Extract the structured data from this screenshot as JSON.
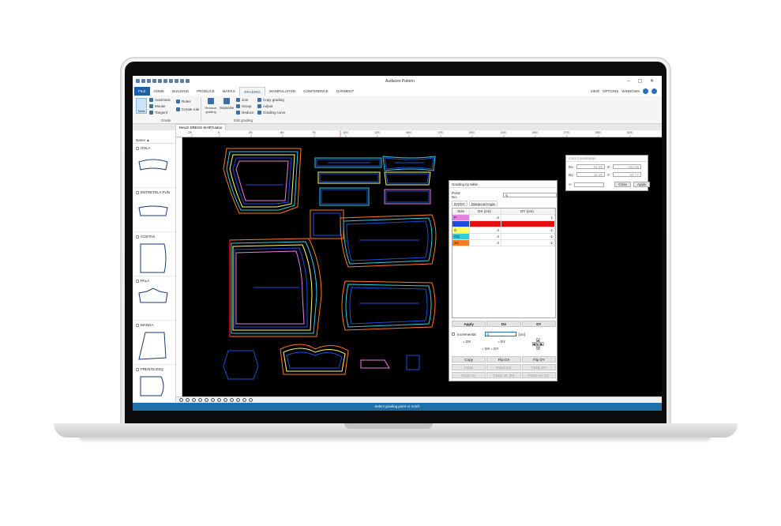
{
  "app": {
    "title": "Audaces Pattern"
  },
  "ribbon_tabs": [
    "FILE",
    "HOME",
    "BUILDING",
    "PRODUCE",
    "MARKS",
    "GRADING",
    "MANIPULATION",
    "CONFERENCE",
    "GARMENT"
  ],
  "ribbon_right": {
    "view": "VIEW",
    "options": "OPTIONS",
    "windows": "WINDOWS"
  },
  "grade_group": {
    "label": "Grade",
    "table": "Table",
    "automatic": "Automatic",
    "mouse": "Mouse",
    "tangent": "Tangent",
    "rules": "Rules",
    "create_rule": "Create rule"
  },
  "edit_group": {
    "label": "Edit grading",
    "remove": "Remove grading",
    "separate": "Separate",
    "join": "Join",
    "group": "Group",
    "deduce": "Deduce",
    "copy": "Copy grading",
    "adjust": "Adjust",
    "curve": "Grading curve"
  },
  "document_tab": "MALE DRESS SHIRT.adox",
  "pieces_header": "Name",
  "pieces": [
    "GOLA",
    "ENTRETELA PUN",
    "COSTAS",
    "PALA",
    "MANGA",
    "FRENTE ESQ"
  ],
  "ruler_ticks": [
    "-25",
    "0",
    "25",
    "50",
    "75",
    "100",
    "125",
    "150",
    "175",
    "200",
    "225",
    "250",
    "275",
    "300",
    "325"
  ],
  "grading_dialog": {
    "title": "Grading by table",
    "point_label": "Point No:",
    "point_value": "6",
    "tabs": [
      "DX/DY",
      "Distance/Angle"
    ],
    "columns": [
      "Size",
      "DX (cm)",
      "DY (cm)"
    ],
    "rows": [
      {
        "size": "P",
        "dx": "-2",
        "dy": "1",
        "color": "#e67ee6"
      },
      {
        "size": "M",
        "dx": "0",
        "dy": "0",
        "color": "#1a4fd6"
      },
      {
        "size": "G",
        "dx": "2",
        "dy": "-1",
        "color": "#ffff66"
      },
      {
        "size": "GG",
        "dx": "2",
        "dy": "-1",
        "color": "#33ccdd"
      },
      {
        "size": "3G",
        "dx": "2",
        "dy": "-1",
        "color": "#ff7a1a"
      }
    ],
    "buttons": {
      "apply": "Apply",
      "dx": "DX",
      "dy": "DY"
    },
    "incremental": "Incremental",
    "incremental_value": "0",
    "unit": "[cm]",
    "eq_dx": "= DX",
    "eq_dy": "= DY",
    "dx_eq_dy": "= DX = DY",
    "copy": "Copy",
    "flip_dx": "Flip DX",
    "flip_dy": "Flip DY",
    "paste": "Paste",
    "paste_dx": "Paste DX",
    "paste_dy": "Paste DY",
    "paste_rel": "Paste rel.",
    "paste_rel_dx": "Paste rel. DX",
    "paste_rel_dy": "Paste rel. DY"
  },
  "coord_dialog": {
    "title": "(cm) Coordinates",
    "dx_label": "Dx:",
    "dx_value": "64.29",
    "dy_label": "Dy:",
    "dy_value": "45.29",
    "x_label": "X:",
    "x_value": "222.36",
    "y_label": "Y:",
    "y_value": "60.77",
    "a_label": "A:",
    "clear": "Clear",
    "apply": "Apply"
  },
  "status": "Select grading point or notch",
  "colors": {
    "accent": "#1f6fa8",
    "pattern_blue": "#1a4fd6",
    "size_orange": "#ff7a1a",
    "size_red": "#e01010"
  }
}
